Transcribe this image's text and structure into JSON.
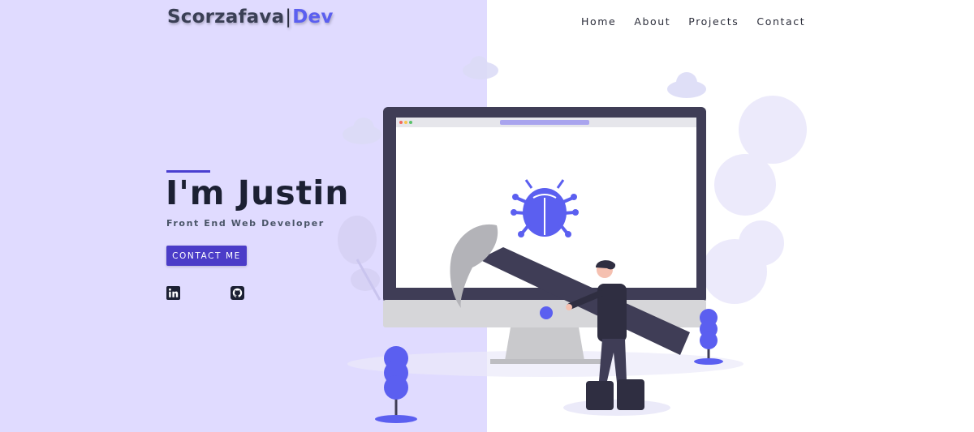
{
  "header": {
    "logo": {
      "brand": "Scorzafava",
      "separator": "|",
      "suffix": "Dev"
    },
    "nav": [
      {
        "label": "Home"
      },
      {
        "label": "About"
      },
      {
        "label": "Projects"
      },
      {
        "label": "Contact"
      }
    ]
  },
  "hero": {
    "title": "I'm Justin",
    "subtitle": "Front End Web Developer",
    "cta_label": "CONTACT ME"
  },
  "social": [
    {
      "icon": "linkedin-icon"
    },
    {
      "icon": "github-icon"
    }
  ],
  "colors": {
    "left_panel": "#e0dbff",
    "accent": "#4b3cc8",
    "logo_suffix": "#5b5ff0",
    "bug": "#5b5ff0"
  },
  "illustration": {
    "icon": "developer-fixing-bug-illustration"
  }
}
